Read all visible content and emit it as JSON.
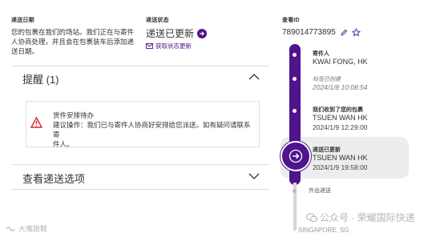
{
  "left": {
    "delivery_date_label": "递送日期",
    "delivery_desc": [
      "您的包裹在我们的场站。我们正在与寄件",
      "人协商处理，并且会在包裹装车后添加递",
      "送日期。"
    ],
    "status_label": "递送状态",
    "status_text": "递送已更新",
    "status_link": "获取状态更新"
  },
  "alerts": {
    "title": "提醒 (1)",
    "notice_title": "货件安排待办",
    "notice_body": [
      "建议操作：我们已与寄件人协商好安排给您派送。如有疑问请联系寄",
      "件人。"
    ]
  },
  "options": {
    "title": "查看递送选项"
  },
  "tracking": {
    "label": "查看ID",
    "number": "789014773895",
    "events": [
      {
        "label": "寄件人",
        "location": "KWAI FONG, HK"
      },
      {
        "label": "标签已创建",
        "time": "2024/1/8 10:08:54"
      },
      {
        "label": "我们收到了您的包裹",
        "location": "TSUEN WAN HK",
        "time": "2024/1/9 12:29:00"
      },
      {
        "label": "递送已更新",
        "location": "TSUEN WAN HK",
        "time": "2024/1/9 19:58:00"
      },
      {
        "label": "外出递送"
      }
    ],
    "partial_location": "SINGAPORE, SG"
  },
  "watermarks": {
    "left": "大嘴跑鞋",
    "right": "公众号 · 荣耀国际快递"
  },
  "colors": {
    "accent": "#4d148c",
    "alert": "#d9262a"
  }
}
